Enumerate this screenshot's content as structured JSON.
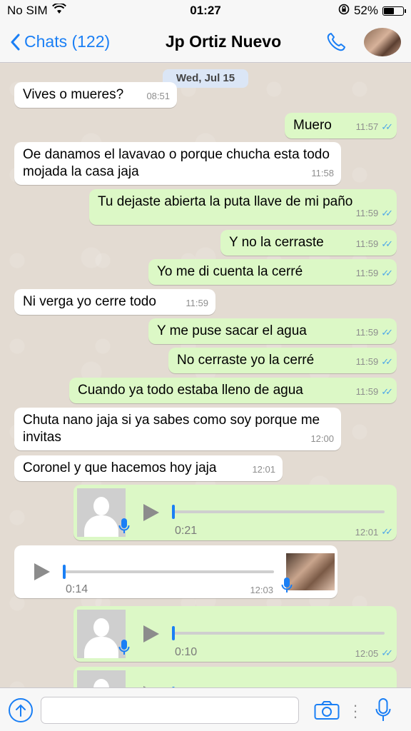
{
  "status_bar": {
    "carrier": "No SIM",
    "time": "01:27",
    "battery": "52%",
    "battery_level": 0.52
  },
  "nav": {
    "back_label": "Chats (122)",
    "title": "Jp Ortiz Nuevo",
    "icons": [
      "chevron-left-icon",
      "phone-icon",
      "avatar"
    ]
  },
  "chat": {
    "date": "Wed, Jul 15",
    "messages": [
      {
        "dir": "in",
        "text": "Vives o mueres?",
        "time": "08:51"
      },
      {
        "dir": "out",
        "text": "Muero",
        "time": "11:57"
      },
      {
        "dir": "in",
        "text": "Oe danamos el lavavao o porque chucha esta todo mojada la casa jaja",
        "time": "11:58"
      },
      {
        "dir": "out",
        "text": "Tu dejaste abierta la puta llave de mi paño",
        "time": "11:59"
      },
      {
        "dir": "out",
        "text": "Y no la cerraste",
        "time": "11:59"
      },
      {
        "dir": "out",
        "text": "Yo me di cuenta la cerré",
        "time": "11:59"
      },
      {
        "dir": "in",
        "text": "Ni verga yo cerre todo",
        "time": "11:59"
      },
      {
        "dir": "out",
        "text": "Y me puse sacar el agua",
        "time": "11:59"
      },
      {
        "dir": "out",
        "text": "No cerraste yo la cerré",
        "time": "11:59"
      },
      {
        "dir": "out",
        "text": "Cuando ya todo estaba lleno de agua",
        "time": "11:59"
      },
      {
        "dir": "in",
        "text": "Chuta nano jaja si ya sabes como soy porque me invitas",
        "time": "12:00"
      },
      {
        "dir": "in",
        "text": "Coronel y que hacemos hoy jaja",
        "time": "12:01"
      }
    ],
    "voice_messages": [
      {
        "dir": "out",
        "duration": "0:21",
        "time": "12:01"
      },
      {
        "dir": "in",
        "duration": "0:14",
        "time": "12:03"
      },
      {
        "dir": "out",
        "duration": "0:10",
        "time": "12:05"
      }
    ]
  },
  "input_bar": {
    "placeholder": "",
    "icons": [
      "upload-icon",
      "camera-icon",
      "more-dots-icon",
      "microphone-icon"
    ]
  },
  "colors": {
    "accent": "#1a7ff5",
    "outgoing_bubble": "#dcf8c6",
    "incoming_bubble": "#ffffff",
    "read_check": "#4fa8e8"
  }
}
